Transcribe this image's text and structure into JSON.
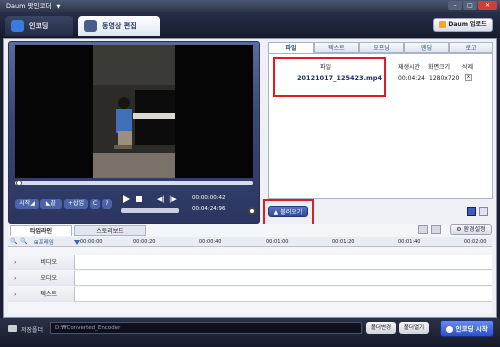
{
  "window": {
    "title": "Daum 팟인코더",
    "menu_arrow": "▼"
  },
  "tabs": {
    "encoding": "인코딩",
    "video_edit": "동영상 편집"
  },
  "upload_button": "Daum 업로드",
  "player": {
    "current_time": "00:00:00:42",
    "total_time": "00:04:24:96",
    "btn_start": "시작",
    "btn_end": "끝",
    "btn_insert": "삽입",
    "btn_c": "C",
    "btn_help": "?"
  },
  "right_tabs": [
    "파일",
    "텍스트",
    "오프닝",
    "엔딩",
    "로고"
  ],
  "file_table": {
    "headers": [
      "파일",
      "재생시간",
      "화면크기",
      "삭제"
    ],
    "rows": [
      {
        "name": "20121017_125423.mp4",
        "duration": "00:04:24",
        "size": "1280x720",
        "delete": "x"
      }
    ]
  },
  "import_button": "불러오기",
  "timeline": {
    "tabs": [
      "타임라인",
      "스토리보드"
    ],
    "settings": "환경설정",
    "frame_label": "프레임",
    "times": [
      "00:00:00",
      "00:00:20",
      "00:00:40",
      "00:01:00",
      "00:01:20",
      "00:01:40",
      "00:02:00"
    ],
    "tracks": [
      "비디오",
      "오디오",
      "텍스트"
    ]
  },
  "bottom": {
    "folder_label": "저장폴더",
    "folder_path": "D:₩Converted_Encoder",
    "change_folder": "폴더변경",
    "open_folder": "폴더열기",
    "start_encoding": "인코딩 시작"
  },
  "colors": {
    "red_highlight": "#e11b22",
    "accent_blue": "#3a5fbf"
  }
}
